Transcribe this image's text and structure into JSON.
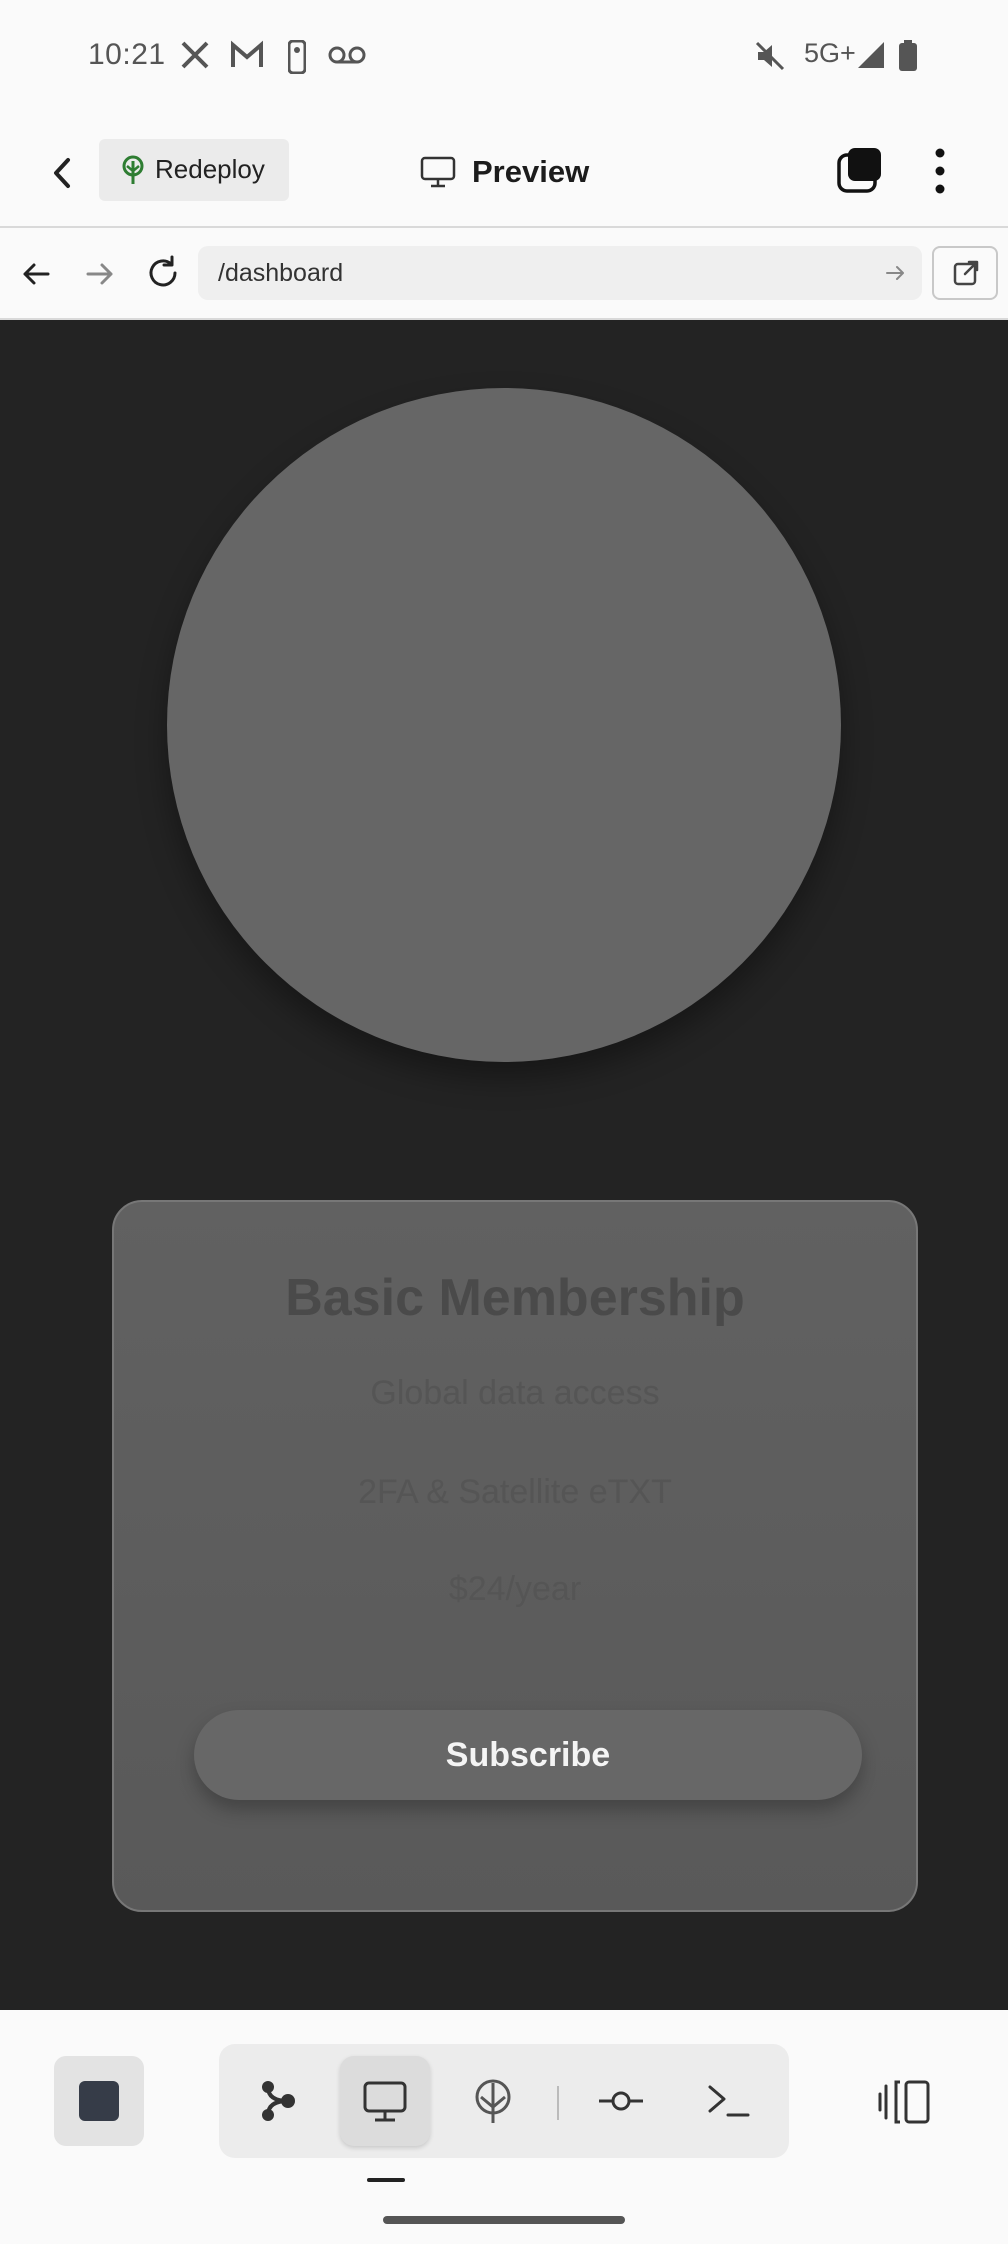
{
  "status_bar": {
    "time": "10:21",
    "network": "5G+",
    "notification_icons": [
      "x-icon",
      "gmail-icon",
      "nba-icon",
      "voicemail-icon"
    ],
    "system_icons": [
      "mute-icon",
      "signal-icon",
      "battery-icon"
    ]
  },
  "header": {
    "redeploy_label": "Redeploy",
    "title": "Preview",
    "accent_color": "#2e7d32"
  },
  "browser": {
    "url": "/dashboard"
  },
  "page": {
    "card": {
      "title": "Basic Membership",
      "features": [
        "Global data access",
        "2FA & Satellite eTXT",
        "$24/year"
      ],
      "cta_label": "Subscribe"
    },
    "colors": {
      "background": "#232323",
      "circle": "#666666",
      "card": "#5e5e5e"
    }
  },
  "toolbar": {
    "tools": [
      "graph-icon",
      "monitor-icon",
      "deploy-icon",
      "commit-icon",
      "terminal-icon"
    ],
    "active_tool": "monitor-icon"
  }
}
